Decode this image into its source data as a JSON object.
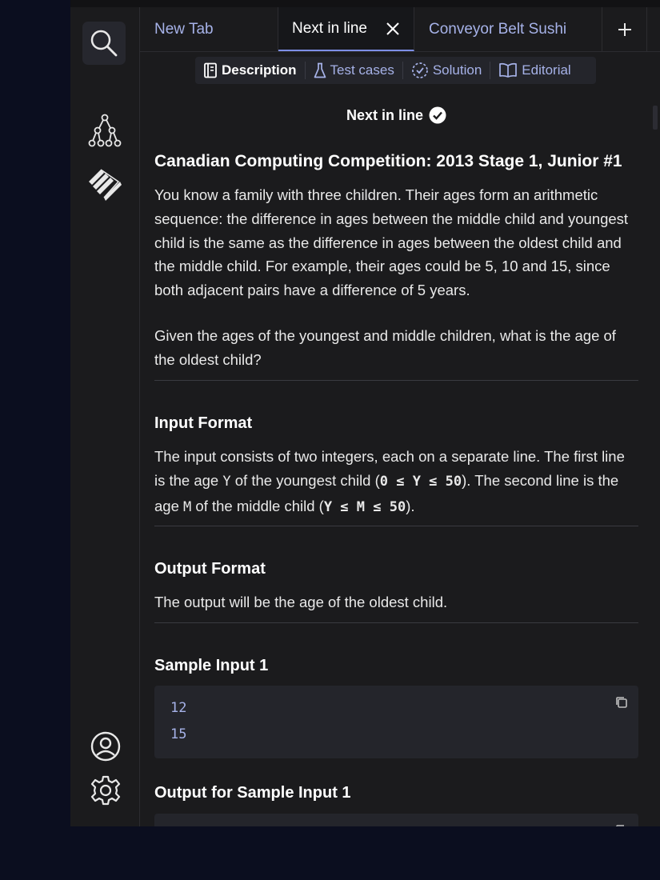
{
  "tabs": [
    {
      "label": "New Tab"
    },
    {
      "label": "Next in line"
    },
    {
      "label": "Conveyor Belt Sushi"
    }
  ],
  "subtabs": [
    {
      "label": "Description"
    },
    {
      "label": "Test cases"
    },
    {
      "label": "Solution"
    },
    {
      "label": "Editorial"
    }
  ],
  "problem": {
    "title": "Next in line",
    "source": "Canadian Computing Competition: 2013 Stage 1, Junior #1",
    "p1": "You know a family with three children. Their ages form an arithmetic sequence: the difference in ages between the middle child and youngest child is the same as the difference in ages between the oldest child and the middle child. For example, their ages could be 5, 10 and 15, since both adjacent pairs have a difference of 5 years.",
    "p2": "Given the ages of the youngest and middle children, what is the age of the oldest child?"
  },
  "input_format": {
    "heading": "Input Format",
    "t1": "The input consists of two integers, each on a separate line. The first line is the age ",
    "var_y": "Y",
    "t2": " of the youngest child (",
    "c1": "0 ≤ Y ≤ 50",
    "t3": "). The second line is the age ",
    "var_m": "M",
    "t4": " of the middle child (",
    "c2": "Y ≤ M ≤ 50",
    "t5": ")."
  },
  "output_format": {
    "heading": "Output Format",
    "text": "The output will be the age of the oldest child."
  },
  "sample_input": {
    "heading": "Sample Input 1",
    "lines": [
      "12",
      "15"
    ]
  },
  "sample_output": {
    "heading": "Output for Sample Input 1"
  },
  "colors": {
    "accent": "#a6b2e8",
    "background": "#1b1b1d",
    "outer_background": "#0b0e1f"
  }
}
